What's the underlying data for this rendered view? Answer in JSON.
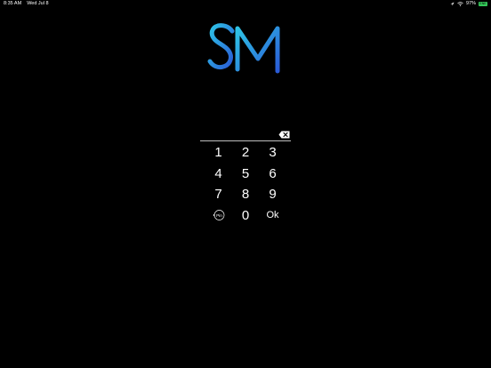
{
  "status_bar": {
    "time": "8:35 AM",
    "date": "Wed Jul 8",
    "battery_percent": "97%",
    "battery_label": "ENE"
  },
  "keypad": {
    "keys": [
      "1",
      "2",
      "3",
      "4",
      "5",
      "6",
      "7",
      "8",
      "9"
    ],
    "zero": "0",
    "pin_label": "Pin",
    "ok_label": "Ok"
  },
  "colors": {
    "background": "#000000",
    "logo_gradient_start": "#2ec4e6",
    "logo_gradient_end": "#2a5bd7",
    "text": "#ffffff",
    "battery": "#34c759"
  },
  "icons": {
    "backspace": "backspace-icon",
    "pin": "pin-rotate-icon",
    "wifi": "wifi-icon",
    "location": "location-icon"
  }
}
